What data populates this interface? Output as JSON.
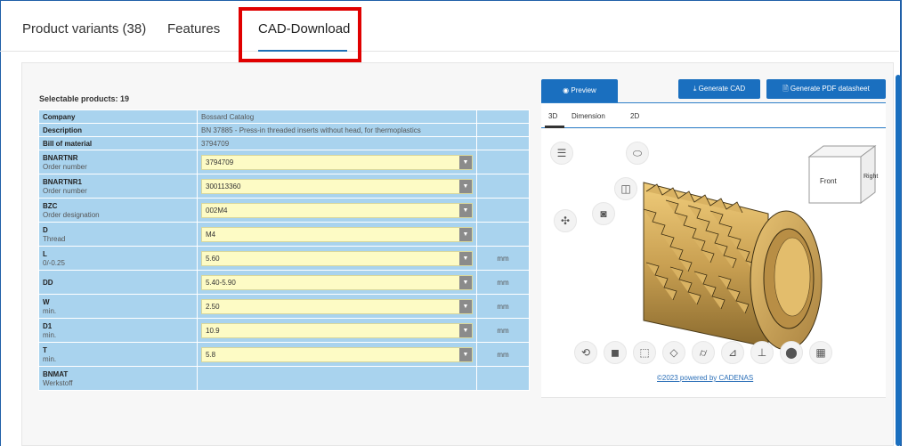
{
  "tabs": [
    {
      "label": "Product variants (38)"
    },
    {
      "label": "Features"
    },
    {
      "label": "CAD-Download"
    }
  ],
  "selectable_products": "Selectable products: 19",
  "rows": [
    {
      "name": "Company",
      "sub": "",
      "value": "Bossard Catalog",
      "unit": "",
      "editable": false
    },
    {
      "name": "Description",
      "sub": "",
      "value": "BN 37885 - Press-in threaded inserts without head, for thermoplastics",
      "unit": "",
      "editable": false
    },
    {
      "name": "Bill of material",
      "sub": "",
      "value": "3794709",
      "unit": "",
      "editable": false
    },
    {
      "name": "BNARTNR",
      "sub": "Order number",
      "value": "3794709",
      "unit": "",
      "editable": true
    },
    {
      "name": "BNARTNR1",
      "sub": "Order number",
      "value": "300113360",
      "unit": "",
      "editable": true
    },
    {
      "name": "BZC",
      "sub": "Order designation",
      "value": "002M4",
      "unit": "",
      "editable": true
    },
    {
      "name": "D",
      "sub": "Thread",
      "value": "M4",
      "unit": "",
      "editable": true
    },
    {
      "name": "L",
      "sub": "0/-0.25",
      "value": "5.60",
      "unit": "mm",
      "editable": true
    },
    {
      "name": "DD",
      "sub": "",
      "value": "5.40-5.90",
      "unit": "mm",
      "editable": true
    },
    {
      "name": "W",
      "sub": "min.",
      "value": "2.50",
      "unit": "mm",
      "editable": true
    },
    {
      "name": "D1",
      "sub": "min.",
      "value": "10.9",
      "unit": "mm",
      "editable": true
    },
    {
      "name": "T",
      "sub": "min.",
      "value": "5.8",
      "unit": "mm",
      "editable": true
    },
    {
      "name": "BNMAT",
      "sub": "Werkstoff",
      "value": "",
      "unit": "",
      "editable": false
    }
  ],
  "preview": {
    "tab_label": "Preview",
    "generate_cad": "Generate CAD",
    "generate_pdf": "Generate PDF datasheet",
    "subtabs": [
      "3D",
      "Dimension",
      "2D"
    ],
    "cube": {
      "front": "Front",
      "right": "Right"
    },
    "powered_by": "©2023 powered by CADENAS"
  },
  "colors": {
    "accent": "#1a6fbf",
    "highlight": "#e00000",
    "table_bg": "#a9d3ee",
    "field_bg": "#fdfbc5",
    "part": "#c9a052"
  }
}
